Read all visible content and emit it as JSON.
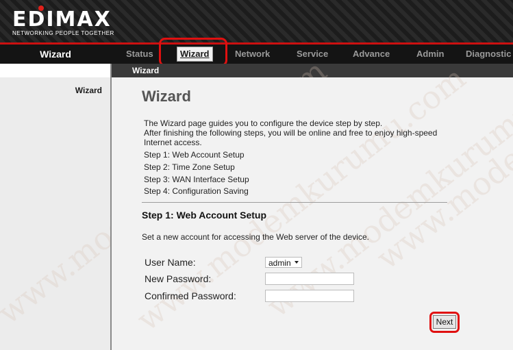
{
  "brand": {
    "logo_text": "EDIMAX",
    "tagline": "NETWORKING PEOPLE TOGETHER",
    "accent_color": "#cc1010"
  },
  "nav": {
    "section_label": "Wizard",
    "items": [
      {
        "label": "Status"
      },
      {
        "label": "Wizard",
        "active": true
      },
      {
        "label": "Network"
      },
      {
        "label": "Service"
      },
      {
        "label": "Advance"
      },
      {
        "label": "Admin"
      },
      {
        "label": "Diagnostic"
      }
    ]
  },
  "subnav": {
    "label": "Wizard"
  },
  "sidebar": {
    "items": [
      {
        "label": "Wizard"
      }
    ]
  },
  "main": {
    "title": "Wizard",
    "intro_line1": "The Wizard page guides you to configure the device step by step.",
    "intro_line2": "After finishing the following steps, you will be online and free to enjoy high-speed Internet access.",
    "steps": [
      "Step 1: Web Account Setup",
      "Step 2: Time Zone Setup",
      "Step 3: WAN Interface Setup",
      "Step 4: Configuration Saving"
    ],
    "section_title": "Step 1: Web Account Setup",
    "section_desc": "Set a new account for accessing the Web server of the device.",
    "form": {
      "username_label": "User Name:",
      "username_value": "admin",
      "new_password_label": "New Password:",
      "new_password_value": "",
      "confirm_password_label": "Confirmed Password:",
      "confirm_password_value": ""
    },
    "next_label": "Next"
  },
  "watermark": {
    "text": "www.modemkurumu.com"
  }
}
